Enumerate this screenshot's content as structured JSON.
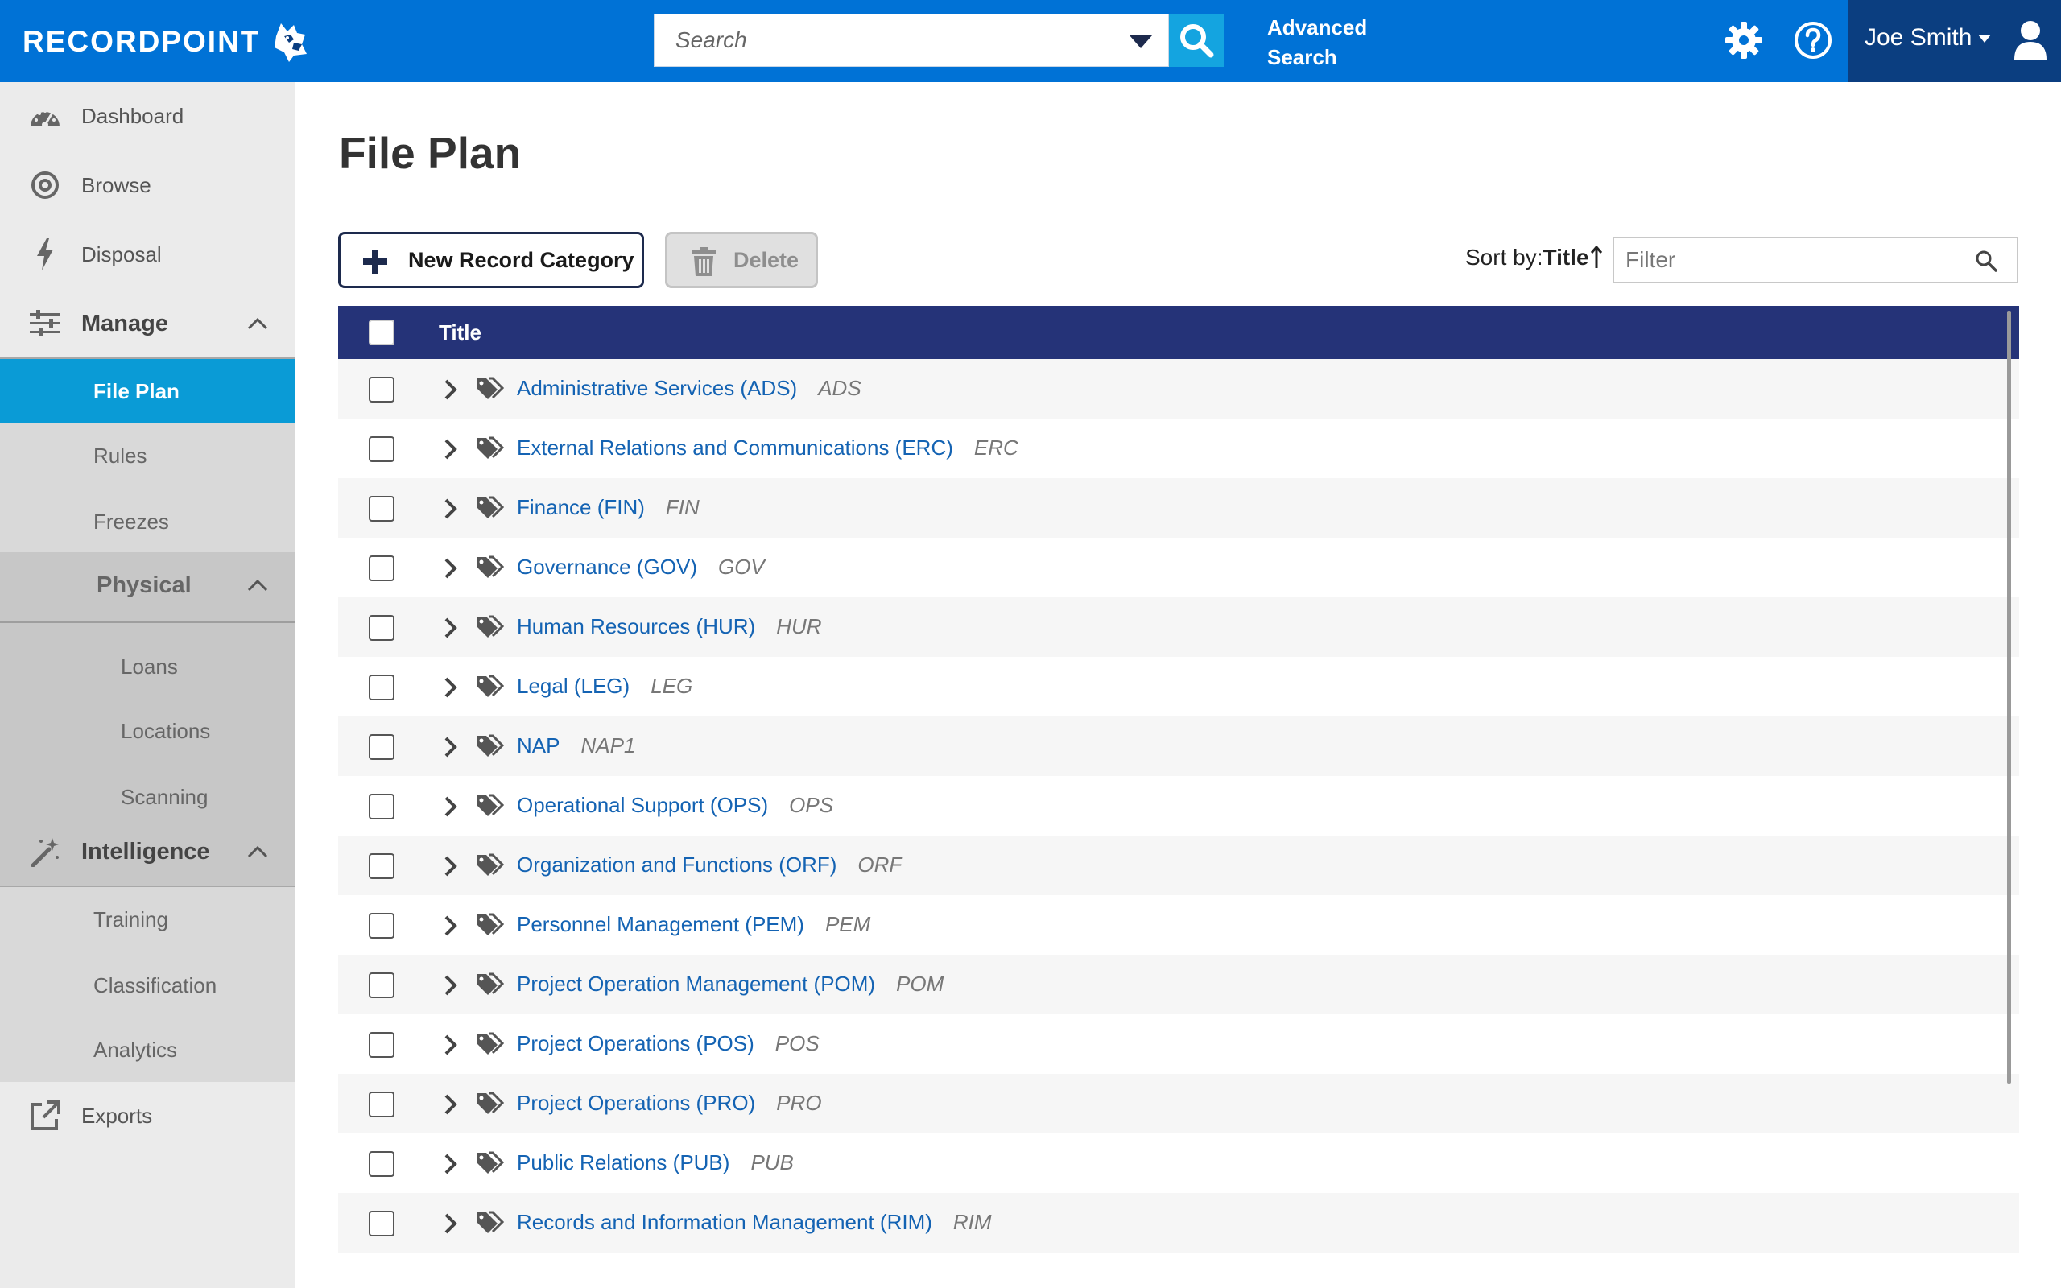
{
  "app": {
    "logo_text": "RECORDPOINT"
  },
  "topbar": {
    "search_placeholder": "Search",
    "advanced_search_line1": "Advanced",
    "advanced_search_line2": "Search",
    "user_name": "Joe Smith",
    "colors": {
      "bar": "#0072d6",
      "search_button": "#14a4e0",
      "user_area": "#0b3e80"
    }
  },
  "sidebar": {
    "items": [
      {
        "label": "Dashboard",
        "icon": "speedometer-icon"
      },
      {
        "label": "Browse",
        "icon": "compass-icon"
      },
      {
        "label": "Disposal",
        "icon": "lightning-icon"
      }
    ],
    "manage": {
      "label": "Manage",
      "icon": "sliders-icon",
      "children": [
        {
          "label": "File Plan",
          "active": true
        },
        {
          "label": "Rules"
        },
        {
          "label": "Freezes"
        }
      ],
      "physical": {
        "label": "Physical",
        "children": [
          {
            "label": "Loans"
          },
          {
            "label": "Locations"
          },
          {
            "label": "Scanning"
          }
        ]
      }
    },
    "intelligence": {
      "label": "Intelligence",
      "icon": "magic-wand-icon",
      "children": [
        {
          "label": "Training"
        },
        {
          "label": "Classification"
        },
        {
          "label": "Analytics"
        }
      ]
    },
    "exports": {
      "label": "Exports",
      "icon": "external-link-icon"
    }
  },
  "main": {
    "title": "File Plan",
    "new_button_label": "New Record Category",
    "delete_button_label": "Delete",
    "sort_prefix": "Sort by:",
    "sort_field": "Title",
    "filter_placeholder": "Filter",
    "table": {
      "header_title": "Title",
      "header_color": "#253378",
      "rows": [
        {
          "title": "Administrative Services (ADS)",
          "code": "ADS"
        },
        {
          "title": "External Relations and Communications (ERC)",
          "code": "ERC"
        },
        {
          "title": "Finance (FIN)",
          "code": "FIN"
        },
        {
          "title": "Governance (GOV)",
          "code": "GOV"
        },
        {
          "title": "Human Resources (HUR)",
          "code": "HUR"
        },
        {
          "title": "Legal (LEG)",
          "code": "LEG"
        },
        {
          "title": "NAP",
          "code": "NAP1"
        },
        {
          "title": "Operational Support (OPS)",
          "code": "OPS"
        },
        {
          "title": "Organization and Functions (ORF)",
          "code": "ORF"
        },
        {
          "title": "Personnel Management (PEM)",
          "code": "PEM"
        },
        {
          "title": "Project Operation Management (POM)",
          "code": "POM"
        },
        {
          "title": "Project Operations (POS)",
          "code": "POS"
        },
        {
          "title": "Project Operations (PRO)",
          "code": "PRO"
        },
        {
          "title": "Public Relations (PUB)",
          "code": "PUB"
        },
        {
          "title": "Records and Information Management (RIM)",
          "code": "RIM"
        }
      ]
    }
  }
}
